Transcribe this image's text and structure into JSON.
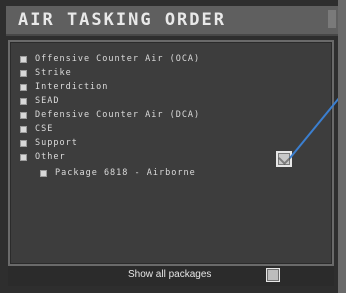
{
  "window": {
    "title": "AIR TASKING ORDER"
  },
  "list": {
    "items": [
      {
        "label": "Offensive Counter Air (OCA)"
      },
      {
        "label": "Strike"
      },
      {
        "label": "Interdiction"
      },
      {
        "label": "SEAD"
      },
      {
        "label": "Defensive Counter Air (DCA)"
      },
      {
        "label": "CSE"
      },
      {
        "label": "Support"
      },
      {
        "label": "Other"
      }
    ],
    "subitems": [
      {
        "label": "Package 6818 - Airborne"
      }
    ]
  },
  "footer": {
    "show_all_label": "Show all packages"
  },
  "colors": {
    "callout_line": "#3b7fd0"
  }
}
